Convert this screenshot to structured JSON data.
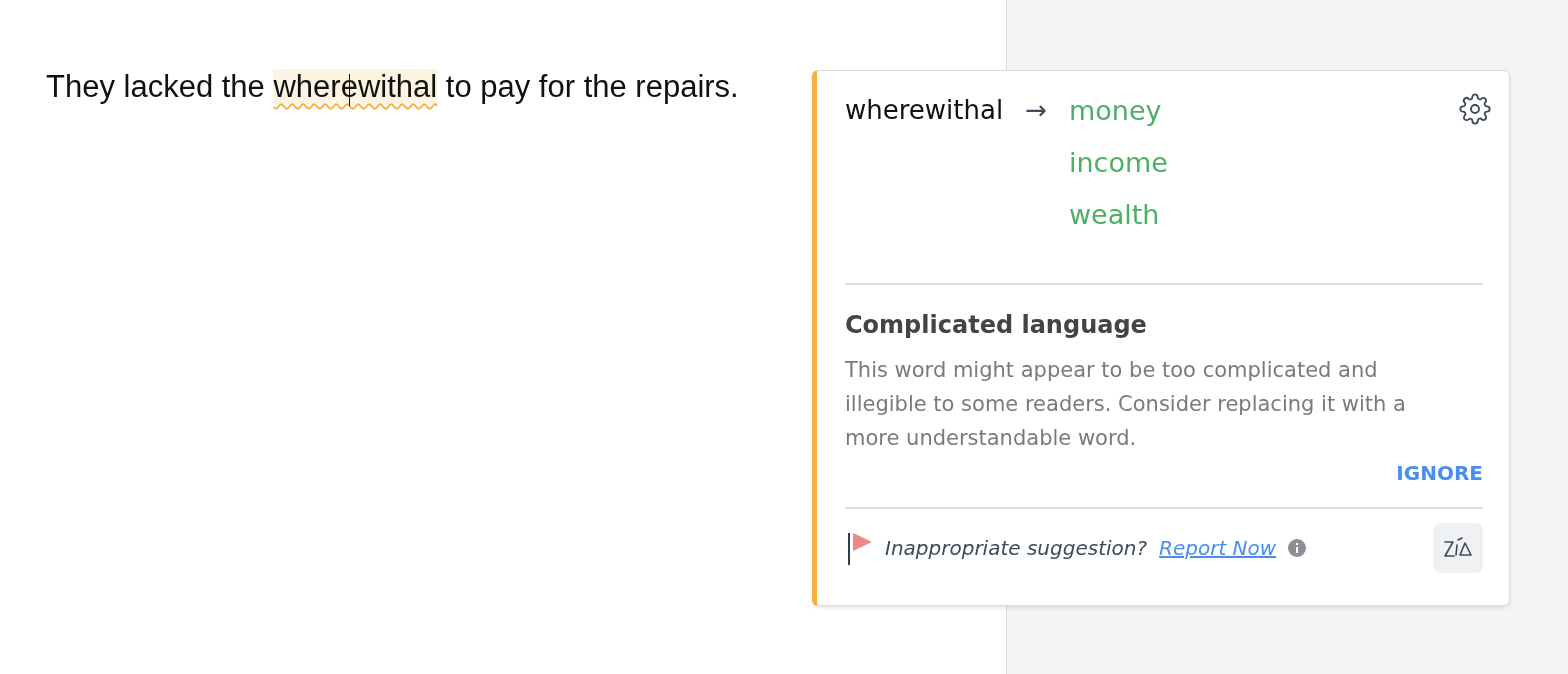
{
  "document": {
    "sentence": {
      "before": "They lacked the ",
      "flagged": "wherewithal",
      "after": " to pay for the repairs."
    }
  },
  "suggestion_card": {
    "original": "wherewithal",
    "arrow": "→",
    "replacements": [
      "money",
      "income",
      "wealth"
    ],
    "title": "Complicated language",
    "description": "This word might appear to be too complicated and illegible to some readers. Consider replacing it with a more understandable word.",
    "ignore_button": "IGNORE",
    "footer": {
      "prompt": "Inappropriate suggestion?",
      "link": "Report Now"
    }
  }
}
